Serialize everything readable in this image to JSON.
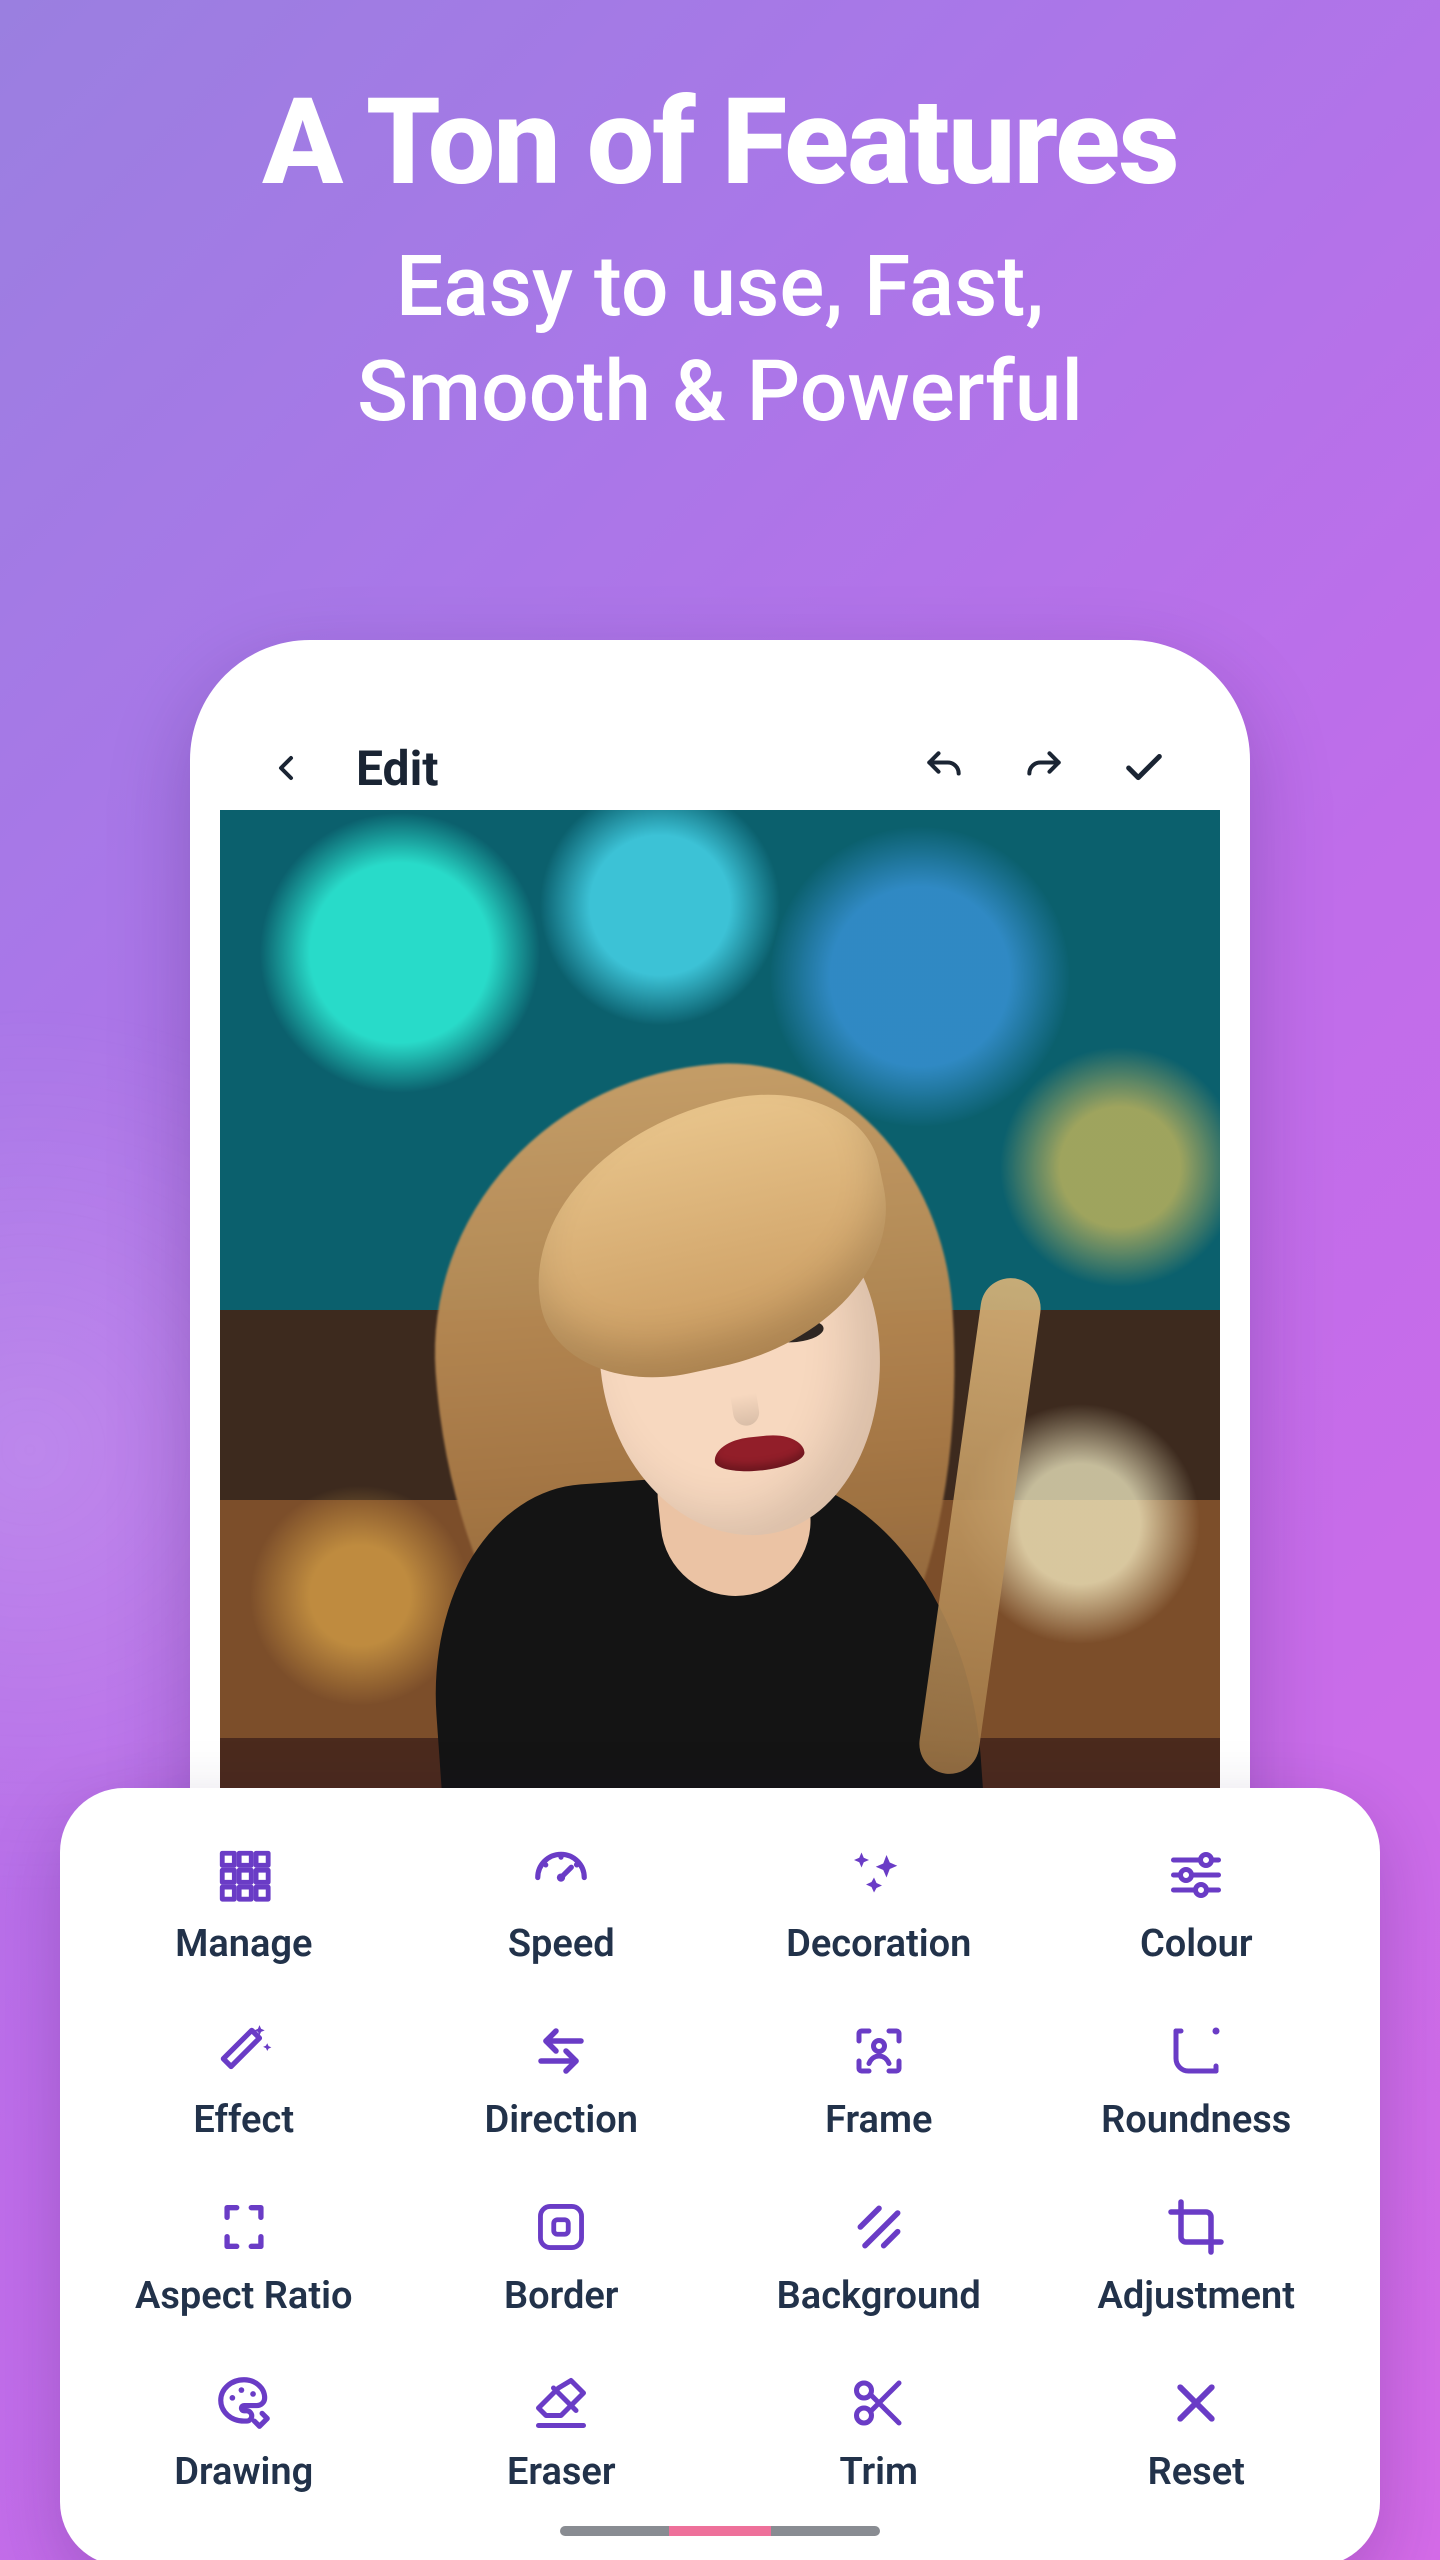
{
  "hero": {
    "title": "A Ton of Features",
    "subtitle_line1": "Easy to use, Fast,",
    "subtitle_line2": "Smooth & Powerful"
  },
  "topbar": {
    "title": "Edit"
  },
  "tools": [
    {
      "id": "manage",
      "label": "Manage"
    },
    {
      "id": "speed",
      "label": "Speed"
    },
    {
      "id": "decoration",
      "label": "Decoration"
    },
    {
      "id": "colour",
      "label": "Colour"
    },
    {
      "id": "effect",
      "label": "Effect"
    },
    {
      "id": "direction",
      "label": "Direction"
    },
    {
      "id": "frame",
      "label": "Frame"
    },
    {
      "id": "roundness",
      "label": "Roundness"
    },
    {
      "id": "aspect",
      "label": "Aspect Ratio"
    },
    {
      "id": "border",
      "label": "Border"
    },
    {
      "id": "background",
      "label": "Background"
    },
    {
      "id": "adjustment",
      "label": "Adjustment"
    },
    {
      "id": "drawing",
      "label": "Drawing"
    },
    {
      "id": "eraser",
      "label": "Eraser"
    },
    {
      "id": "trim",
      "label": "Trim"
    },
    {
      "id": "reset",
      "label": "Reset"
    }
  ],
  "colors": {
    "accent": "#6a3cc6",
    "text": "#22324a"
  }
}
